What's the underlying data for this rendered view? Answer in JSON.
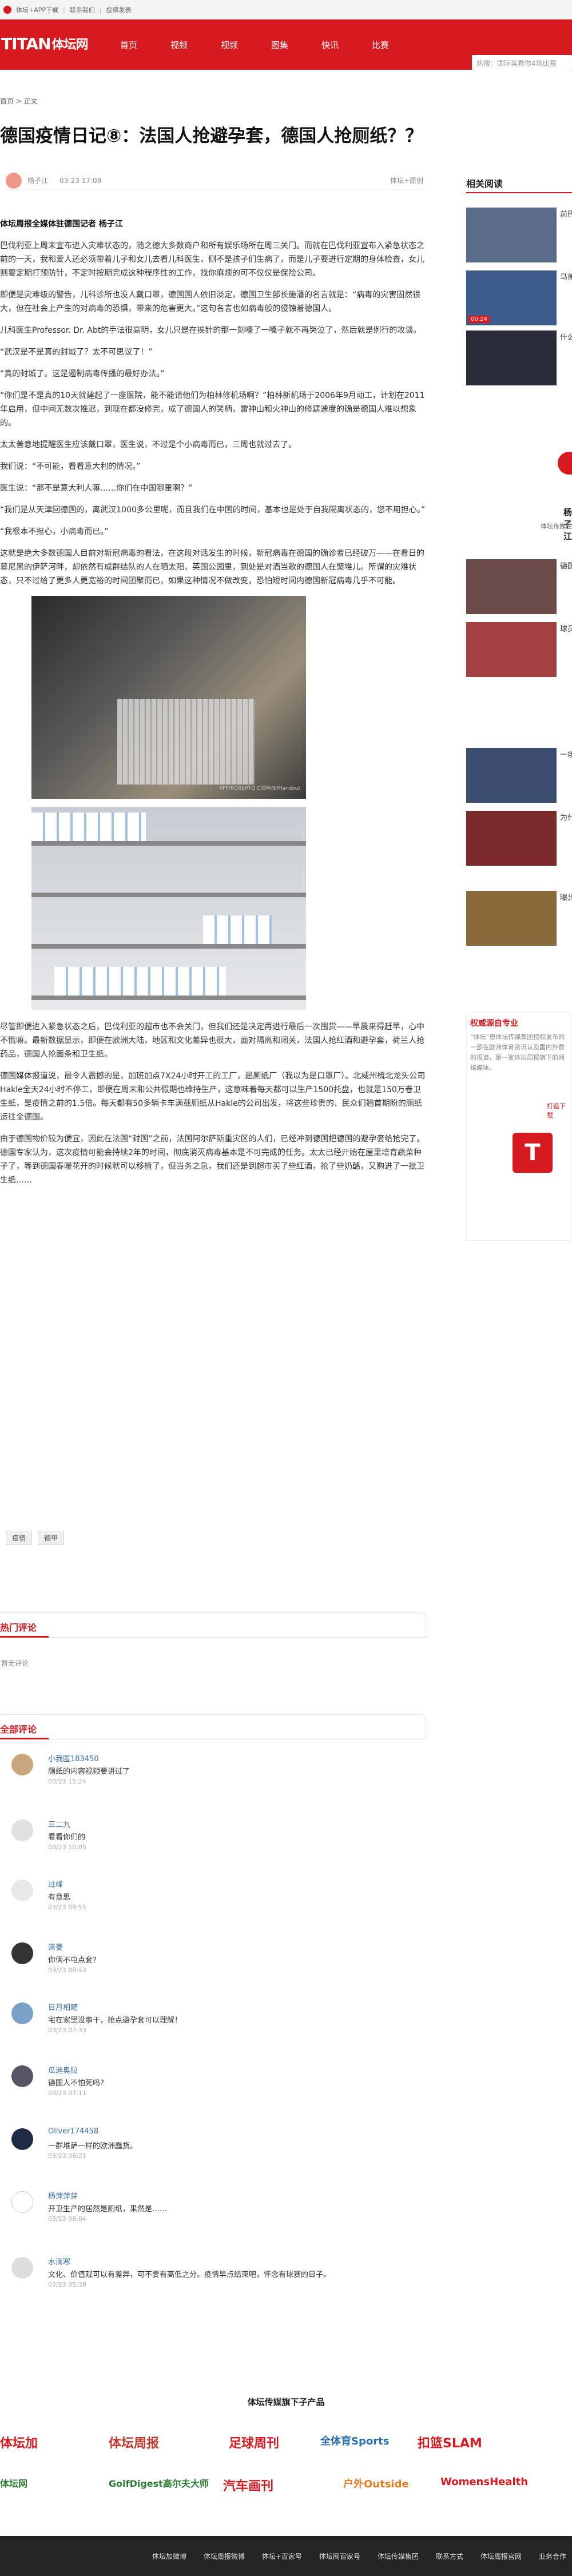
{
  "topbar": {
    "app": "体坛+APP下载",
    "links": [
      "联系我们",
      "投稿发表"
    ]
  },
  "nav": {
    "logo": "TITAN",
    "logo_cn": "体坛网",
    "items": [
      "首页",
      "视频",
      "视频",
      "图集",
      "快讯",
      "比赛"
    ],
    "search_placeholder": "热搜：国际美看你4场比赛"
  },
  "breadcrumb": "首页 > 正文",
  "article": {
    "title": "德国疫情日记⑧：法国人抢避孕套，德国人抢厕纸？？",
    "author": "杨子江",
    "date": "03-23 17:08",
    "source": "体坛+原创",
    "lead": "体坛周报全媒体驻德国记者 杨子江",
    "paragraphs": [
      "巴伐利亚上周末宣布进入灾难状态的，随之德大多数商户和所有娱乐场所在周三关门。而就在巴伐利亚宣布入紧急状态之前的一天，我和爱人还必须带着儿子和女儿去看儿科医生，侧不是孩子们生病了，而是儿子要进行定期的身体检查，女儿则要定期打预防针，不定时按期完成这种程序性的工作，找你麻烦的可不仅仅是保险公司。",
      "即便是灾难级的警告，儿科诊所也没人戴口罩，德国国人依旧淡定，德国卫生部长施潘的名言就是：“病毒的灾害固然很大，但在社会上产生的对病毒的恐惧，带来的危害更大。”这句名言也如病毒般的侵蚀着德国人。",
      "儿科医生Professor. Dr. Abt的手法很高明，女儿只是在挨针的那一刻嚎了一嗓子就不再哭泣了，然后就是例行的攻谈。",
      "“武汉是不是真的封城了？太不可思议了！”",
      "“真的封城了。这是遏制病毒传播的最好办法。”",
      "“你们是不是真的10天就建起了一座医院，能不能请他们为柏林修机场啊？”柏林新机场于2006年9月动工，计划在2011年启用，但中间无数次推迟，到现在都没修完，成了德国人的笑柄，雷神山和火神山的修建速度的确是德国人难以想象的。",
      "太太善意地提醒医生应该戴口罩，医生说，不过是个小病毒而已，三周也就过去了。",
      "我们说：“不可能，看看意大利的情况。”",
      "医生说：“那不是意大利人嘛……你们在中国哪里啊？”",
      "“我们是从天津回德国的，离武汉1000多公里呢，而且我们在中国的时间，基本也是处于自我隔离状态的，您不用担心。”",
      "“我根本不担心，小病毒而已。”",
      "这就是绝大多数德国人目前对新冠病毒的看法，在这段对话发生的时候，新冠病毒在德国的确诊者已经破万——在看日的暮尼黑的伊萨河畔，却依然有成群结队的人在晒太阳，英国公园里，到处是对酒当歌的德国人在聚堆儿。所谓的灾难状态，只不过给了更多人更宽裕的时间团聚而已，如果这种情况不做改变，恐怕短时间内德国新冠病毒几乎不可能。",
      "尽管即便进入紧急状态之后，巴伐利亚的超市也不会关门，但我们还是决定再进行最后一次囤货——早晨来得赶早，心中不慌嘛。最新数据显示，即便在欧洲大陆，地区和文化差异也很大，面对隔离和闭关，法国人抢红酒和避孕套，荷兰人抢药品，德国人抢面条和卫生纸。",
      "德国媒体报道说，最令人震撼的是，加班加点7X24小时开工的工厂，是厕纸厂（我以为是口罩厂）。北威州梳北龙头公司Hakle全天24小时不停工，即便在周末和公共假期也维持生产，这意味着每天都可以生产1500托盘，也就是150万卷卫生纸，是疫情之前的1.5倍。每天都有50多辆卡车满载厕纸从Hakle的公司出发，将这些珍贵的、民众们翘首期盼的厕纸运往全德国。",
      "由于德国物价较为便宜，因此在法国“封国”之前，法国阿尔萨斯重灾区的人们，已经冲到德国把德国的避孕套给抢完了。德国专家认为，这次疫情可能会持续2年的时间，彻底消灭病毒基本是不可完成的任务。太太已经开始在屋里培育蔬菜种子了，等到德国春暖花开的时候就可以移植了，但当务之急，我们还是到超市买了些红酒，抢了些奶酪，又购进了一批卫生纸……"
    ],
    "photo_caption": "AFP/ROBERTO CIEFANI/Handout",
    "tags": [
      "疫情",
      "德甲"
    ]
  },
  "hot_comments": {
    "title": "热门评论",
    "empty": "暂无评论"
  },
  "all_comments": {
    "title": "全部评论",
    "items": [
      {
        "user": "小我匿183450",
        "text": "厕纸的内容视频要讲过了",
        "date": "03/23 15:24"
      },
      {
        "user": "三二九",
        "text": "看看你们的",
        "date": "03/23 10:05"
      },
      {
        "user": "过峰",
        "text": "有意思",
        "date": "03/23 09:55"
      },
      {
        "user": "清菱",
        "text": "你俩不屯点套？",
        "date": "03/23 08:43"
      },
      {
        "user": "日月相随",
        "text": "宅在家里没事干，抢点避孕套可以理解！",
        "date": "03/23 07:33"
      },
      {
        "user": "瓜迪奥拉",
        "text": "德国人不怕死吗?",
        "date": "03/23 07:11"
      },
      {
        "user": "Oliver174458",
        "text": "一群堆萨一样的欧洲蠢货。",
        "date": "03/23 06:21"
      },
      {
        "user": "杨萍萍芽",
        "text": "开卫生产的居然是厕纸，果然是……",
        "date": "03/23 06:04"
      },
      {
        "user": "水滴寒",
        "text": "文化、价值观可以有差异，可不要有高低之分。疫情早点结束吧，怀念有球赛的日子。",
        "date": "03/23 05:39"
      }
    ]
  },
  "sidebar": {
    "title": "相关阅读",
    "items": [
      {
        "text": "前巴萨"
      },
      {
        "text": "马德里"
      },
      {
        "text": "什么"
      },
      {
        "text": "德国"
      },
      {
        "text": "球员"
      },
      {
        "text": "一场"
      },
      {
        "text": "为什么"
      },
      {
        "text": "曝光"
      }
    ],
    "video_badge": "00:24",
    "author_name": "杨子江",
    "author_desc": "体坛传媒驻德国记者",
    "copyright": {
      "title": "权威源自专业",
      "desc": "“体坛”曾体坛传媒集团授权发布的一部在欧洲体育资讯认及国内外数的报道，是一家体坛周报旗下的网络媒体。",
      "link": "打造下载",
      "logo": "T"
    }
  },
  "products": {
    "title": "体坛传媒旗下子产品",
    "items": [
      "体坛加",
      "体坛周报",
      "足球周刊",
      "全体育Sports",
      "扣篮SLAM",
      "体坛网",
      "GolfDigest高尔夫大师",
      "汽车画刊",
      "户外Outside",
      "WomensHealth"
    ]
  },
  "footer": {
    "links": [
      "体坛加微博",
      "体坛周报微博",
      "体坛+百家号",
      "体坛网百家号",
      "体坛传媒集团",
      "联系方式",
      "体坛周报官网",
      "业务合作"
    ]
  },
  "colors": {
    "brand": "#d71920"
  }
}
